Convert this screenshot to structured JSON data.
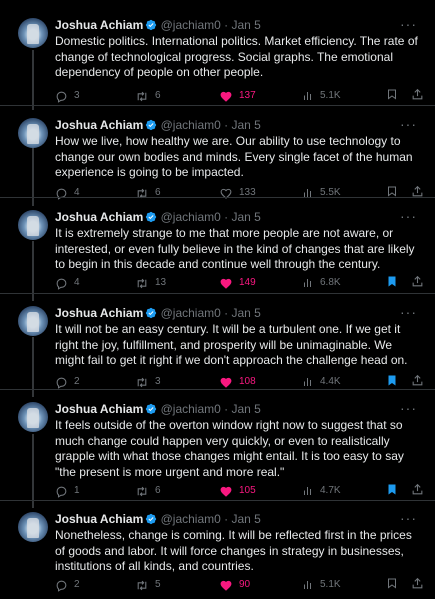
{
  "colors": {
    "background": "#000000",
    "text": "#e7e9ea",
    "muted": "#71767b",
    "like": "#f91880",
    "verified": "#1d9bf0"
  },
  "tweets": [
    {
      "name": "Joshua Achiam",
      "handle": "@jachiam0",
      "sep": "·",
      "date": "Jan 5",
      "text": "Domestic politics. International politics. Market efficiency. The rate of change of technological progress. Social graphs. The emotional dependency of people on other people.",
      "replies": "3",
      "retweets": "6",
      "likes": "137",
      "views": "5.1K",
      "liked": true,
      "bookmarked": false
    },
    {
      "name": "Joshua Achiam",
      "handle": "@jachiam0",
      "sep": "·",
      "date": "Jan 5",
      "text": "How we live, how healthy we are. Our ability to use technology to change our own bodies and minds. Every single facet of the human experience is going to be impacted.",
      "replies": "4",
      "retweets": "6",
      "likes": "133",
      "views": "5.5K",
      "liked": false,
      "bookmarked": false
    },
    {
      "name": "Joshua Achiam",
      "handle": "@jachiam0",
      "sep": "·",
      "date": "Jan 5",
      "text": "It is extremely strange to me that more people are not aware, or interested, or even fully believe in the kind of changes that are likely to begin in this decade and continue well through the century.",
      "replies": "4",
      "retweets": "13",
      "likes": "149",
      "views": "6.8K",
      "liked": true,
      "bookmarked": true
    },
    {
      "name": "Joshua Achiam",
      "handle": "@jachiam0",
      "sep": "·",
      "date": "Jan 5",
      "text": "It will not be an easy century. It will be a turbulent one. If we get it right the joy, fulfillment, and prosperity will be unimaginable. We might fail to get it right if we don't approach the challenge head on.",
      "replies": "2",
      "retweets": "3",
      "likes": "108",
      "views": "4.4K",
      "liked": true,
      "bookmarked": true
    },
    {
      "name": "Joshua Achiam",
      "handle": "@jachiam0",
      "sep": "·",
      "date": "Jan 5",
      "text": "It feels outside of the overton window right now to suggest that so much change could happen very quickly, or even to realistically grapple with what those changes might entail. It is too easy to say \"the present is more urgent and more real.\"",
      "replies": "1",
      "retweets": "6",
      "likes": "105",
      "views": "4.7K",
      "liked": true,
      "bookmarked": true
    },
    {
      "name": "Joshua Achiam",
      "handle": "@jachiam0",
      "sep": "·",
      "date": "Jan 5",
      "text": "Nonetheless, change is coming. It will be reflected first in the prices of goods and labor. It will force changes in strategy in businesses, institutions of all kinds, and countries.",
      "replies": "2",
      "retweets": "5",
      "likes": "90",
      "views": "5.1K",
      "liked": true,
      "bookmarked": false
    }
  ]
}
